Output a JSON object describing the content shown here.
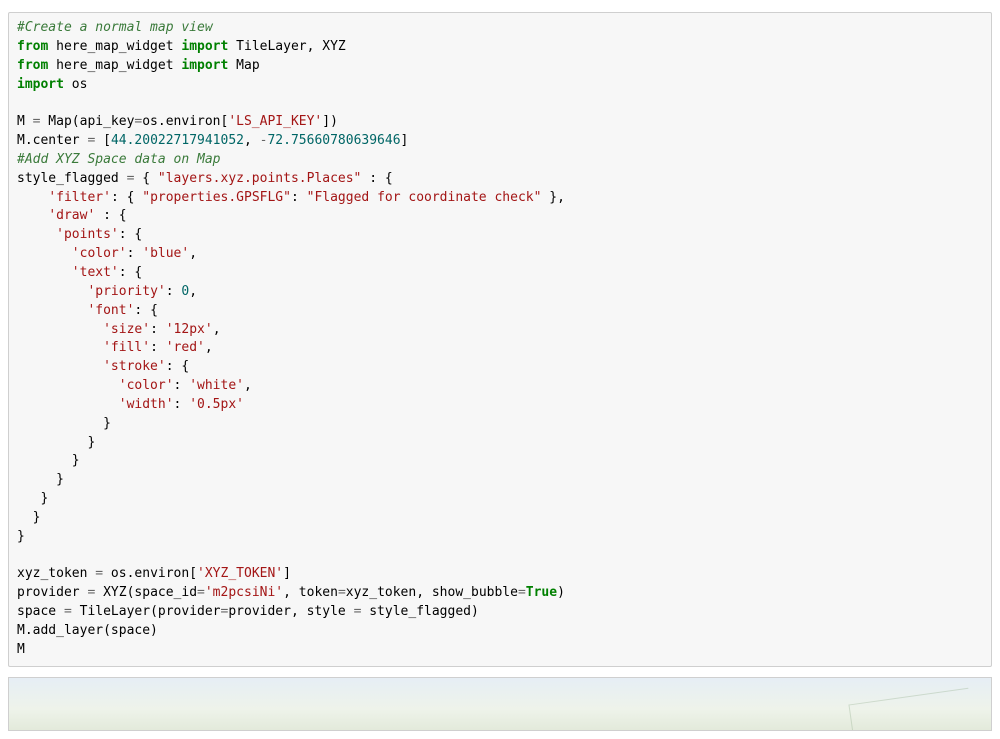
{
  "code": {
    "comment1": "#Create a normal map view",
    "line_from": "from",
    "line_import": "import",
    "mod": "here_map_widget",
    "imports1": "TileLayer, XYZ",
    "imports2": "Map",
    "import_os": "os",
    "assign_M": "M ",
    "eq": "=",
    "map_call": " Map(api_key",
    "os_environ": "os.environ[",
    "key1": "'LS_API_KEY'",
    "rb": "])",
    "mcenter": "M.center ",
    "lbrack": " [",
    "num1": "44.20022717941052",
    "comma": ", ",
    "neg": "-",
    "num2": "72.75660780639646",
    "rbrack": "]",
    "comment2": "#Add XYZ Space data on Map",
    "style_flagged": "style_flagged ",
    "dict_open": " { ",
    "layers_key": "\"layers.xyz.points.Places\"",
    "colon_brace": " : {",
    "filter_key": "'filter'",
    "prop_key": "\"properties.GPSFLG\"",
    "prop_val": "\"Flagged for coordinate check\"",
    "draw_key": "'draw'",
    "points_key": "'points'",
    "color_key": "'color'",
    "blue": "'blue'",
    "text_key": "'text'",
    "priority_key": "'priority'",
    "zero": "0",
    "font_key": "'font'",
    "size_key": "'size'",
    "size_val": "'12px'",
    "fill_key": "'fill'",
    "red": "'red'",
    "stroke_key": "'stroke'",
    "white": "'white'",
    "width_key": "'width'",
    "width_val": "'0.5px'",
    "xyz_token": "xyz_token ",
    "xyz_env": "'XYZ_TOKEN'",
    "provider": "provider ",
    "xyz_call": " XYZ(space_id",
    "space_id": "'m2pcsiNi'",
    "token_arg": ", token",
    "xyz_token_ref": "xyz_token, show_bubble",
    "true": "True",
    "rparen": ")",
    "space_var": "space ",
    "tile_call": " TileLayer(provider",
    "provider_ref": "provider, style ",
    "style_ref": " style_flagged)",
    "add_layer": "M.add_layer(space)",
    "M_last": "M"
  }
}
